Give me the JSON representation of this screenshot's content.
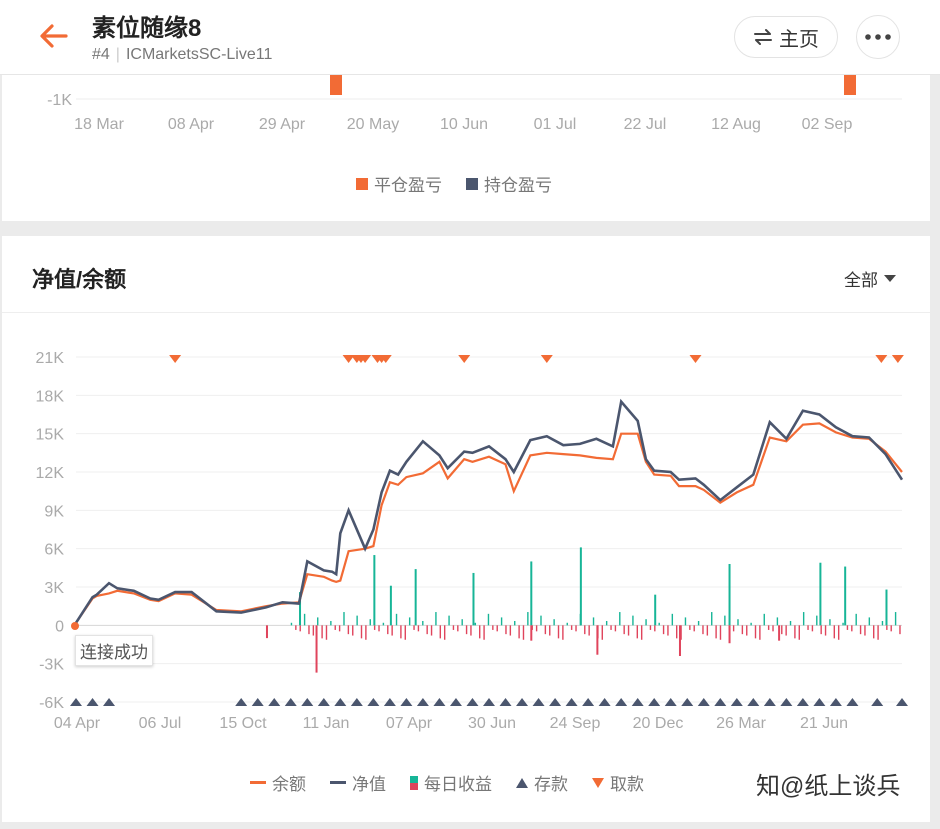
{
  "header": {
    "title": "素位随缘8",
    "rank": "#4",
    "server": "ICMarketsSC-Live11",
    "home_label": "主页"
  },
  "pnl_card": {
    "y_tick": "-1K",
    "x_ticks": [
      "18 Mar",
      "08 Apr",
      "29 Apr",
      "20 May",
      "10 Jun",
      "01 Jul",
      "22 Jul",
      "12 Aug",
      "02 Sep"
    ],
    "legend": [
      "平仓盈亏",
      "持仓盈亏"
    ],
    "colors": {
      "closed": "#f26b35",
      "floating": "#4b566e"
    }
  },
  "equity_card": {
    "title": "净值/余额",
    "filter": "全部",
    "tooltip": "连接成功",
    "legend": {
      "balance": "余额",
      "equity": "净值",
      "daily": "每日收益",
      "deposit": "存款",
      "withdraw": "取款"
    },
    "colors": {
      "balance": "#f26b35",
      "equity": "#4b566e",
      "daily_pos": "#17b597",
      "daily_neg": "#e0445c",
      "deposit": "#4b566e",
      "withdraw": "#f26b35"
    }
  },
  "watermark": "知@纸上谈兵",
  "chart_data": [
    {
      "type": "bar",
      "title": "",
      "categories": [
        "18 Mar",
        "08 Apr",
        "29 Apr",
        "20 May",
        "10 Jun",
        "01 Jul",
        "22 Jul",
        "12 Aug",
        "02 Sep"
      ],
      "yticks": [
        "-1K"
      ],
      "series": [
        {
          "name": "平仓盈亏",
          "bars": [
            {
              "date": "14 May",
              "value": 1000
            },
            {
              "date": "12 Sep",
              "value": 1000
            }
          ]
        },
        {
          "name": "持仓盈亏",
          "bars": []
        }
      ]
    },
    {
      "type": "line",
      "title": "净值/余额",
      "x_ticks": [
        "04 Apr",
        "06 Jul",
        "15 Oct",
        "11 Jan",
        "07 Apr",
        "30 Jun",
        "24 Sep",
        "20 Dec",
        "26 Mar",
        "21 Jun"
      ],
      "y_ticks": [
        "21K",
        "18K",
        "15K",
        "12K",
        "9K",
        "6K",
        "3K",
        "0",
        "-3K",
        "-6K"
      ],
      "ylim": [
        -6000,
        21000
      ],
      "x": [
        0.0,
        0.02,
        0.025,
        0.04,
        0.05,
        0.07,
        0.09,
        0.1,
        0.12,
        0.14,
        0.17,
        0.2,
        0.23,
        0.25,
        0.27,
        0.28,
        0.3,
        0.31,
        0.315,
        0.32,
        0.33,
        0.35,
        0.36,
        0.37,
        0.38,
        0.39,
        0.4,
        0.42,
        0.44,
        0.45,
        0.47,
        0.48,
        0.5,
        0.52,
        0.53,
        0.55,
        0.57,
        0.59,
        0.61,
        0.63,
        0.65,
        0.66,
        0.68,
        0.69,
        0.7,
        0.72,
        0.73,
        0.75,
        0.76,
        0.78,
        0.8,
        0.82,
        0.84,
        0.86,
        0.88,
        0.9,
        0.92,
        0.94,
        0.96,
        0.98,
        1.0
      ],
      "series": [
        {
          "name": "余额",
          "values": [
            200,
            2100,
            2300,
            2500,
            2700,
            2500,
            2000,
            1900,
            2500,
            2400,
            1200,
            1100,
            1500,
            1700,
            1800,
            4000,
            3800,
            3500,
            3400,
            3500,
            5800,
            6000,
            6200,
            9400,
            11200,
            11000,
            11600,
            11900,
            12800,
            11500,
            13000,
            12800,
            13200,
            12600,
            10500,
            13300,
            13500,
            13400,
            13300,
            13100,
            13000,
            15000,
            15000,
            12800,
            11800,
            11700,
            10900,
            10900,
            10600,
            9600,
            10400,
            11000,
            14700,
            14400,
            15700,
            15800,
            15100,
            14700,
            14600,
            13600,
            12000
          ]
        },
        {
          "name": "净值",
          "values": [
            200,
            2200,
            2400,
            3300,
            2900,
            2700,
            2100,
            2000,
            2600,
            2600,
            1100,
            1000,
            1400,
            1800,
            1700,
            5000,
            4300,
            4200,
            4000,
            7200,
            9000,
            6000,
            7500,
            10400,
            12100,
            11800,
            12800,
            14400,
            13300,
            12300,
            13600,
            13500,
            14000,
            13000,
            12000,
            14500,
            14800,
            14100,
            14200,
            14600,
            14000,
            17500,
            16000,
            13000,
            12100,
            12000,
            11400,
            11500,
            11000,
            9800,
            10800,
            11800,
            15900,
            14600,
            16800,
            16500,
            15500,
            14800,
            14700,
            13400,
            11400
          ]
        },
        {
          "name": "每日收益",
          "bars_pos": [
            {
              "x": 0.27,
              "value": 2600
            },
            {
              "x": 0.36,
              "value": 5500
            },
            {
              "x": 0.38,
              "value": 3100
            },
            {
              "x": 0.41,
              "value": 4400
            },
            {
              "x": 0.48,
              "value": 4100
            },
            {
              "x": 0.55,
              "value": 5000
            },
            {
              "x": 0.61,
              "value": 6100
            },
            {
              "x": 0.7,
              "value": 2400
            },
            {
              "x": 0.79,
              "value": 4800
            },
            {
              "x": 0.9,
              "value": 4900
            },
            {
              "x": 0.93,
              "value": 4600
            },
            {
              "x": 0.98,
              "value": 2800
            }
          ],
          "bars_neg": [
            {
              "x": 0.23,
              "value": -1000
            },
            {
              "x": 0.29,
              "value": -3700
            },
            {
              "x": 0.55,
              "value": -1200
            },
            {
              "x": 0.63,
              "value": -2300
            },
            {
              "x": 0.73,
              "value": -2400
            },
            {
              "x": 0.79,
              "value": -1400
            },
            {
              "x": 0.85,
              "value": -1200
            }
          ]
        },
        {
          "name": "存款",
          "x": [
            0.0,
            0.02,
            0.04,
            0.2,
            0.22,
            0.24,
            0.26,
            0.28,
            0.3,
            0.32,
            0.34,
            0.36,
            0.38,
            0.4,
            0.42,
            0.44,
            0.46,
            0.48,
            0.5,
            0.52,
            0.54,
            0.56,
            0.58,
            0.6,
            0.62,
            0.64,
            0.66,
            0.68,
            0.7,
            0.72,
            0.74,
            0.76,
            0.78,
            0.8,
            0.82,
            0.84,
            0.86,
            0.88,
            0.9,
            0.92,
            0.94,
            0.97,
            1.0
          ]
        },
        {
          "name": "取款",
          "x": [
            0.12,
            0.33,
            0.34,
            0.345,
            0.35,
            0.365,
            0.37,
            0.375,
            0.47,
            0.57,
            0.75,
            0.975,
            0.995
          ]
        }
      ]
    }
  ]
}
